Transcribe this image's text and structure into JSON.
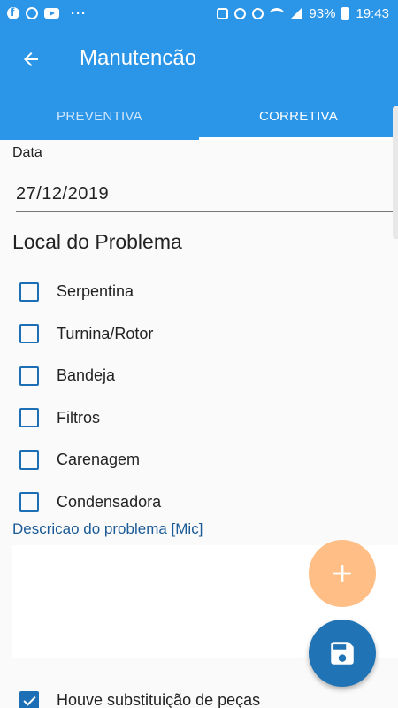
{
  "status_bar": {
    "left_icons": [
      "facebook-icon",
      "whatsapp-icon",
      "youtube-icon",
      "more-notifications-icon"
    ],
    "more": "···",
    "battery": "93%",
    "time": "19:43"
  },
  "app_bar": {
    "title": "Manutencão",
    "back_icon": "arrow-left-icon"
  },
  "tabs": [
    {
      "label": "PREVENTIVA",
      "active": false
    },
    {
      "label": "CORRETIVA",
      "active": true
    }
  ],
  "form": {
    "date_label": "Data",
    "date_value": "27/12/2019",
    "section_title": "Local do Problema",
    "checks": [
      {
        "label": "Serpentina",
        "checked": false
      },
      {
        "label": "Turnina/Rotor",
        "checked": false
      },
      {
        "label": "Bandeja",
        "checked": false
      },
      {
        "label": "Filtros",
        "checked": false
      },
      {
        "label": "Carenagem",
        "checked": false
      },
      {
        "label": "Condensadora",
        "checked": false
      }
    ],
    "description_label": "Descricao do problema [Mic]",
    "description_value": "",
    "replacement_label": "Houve substituição de peças",
    "replacement_checked": true
  },
  "colors": {
    "primary": "#2b95e8",
    "accent_fab": "#ffbe85",
    "save_fab": "#2074b5",
    "checkbox": "#1c6fb5"
  }
}
